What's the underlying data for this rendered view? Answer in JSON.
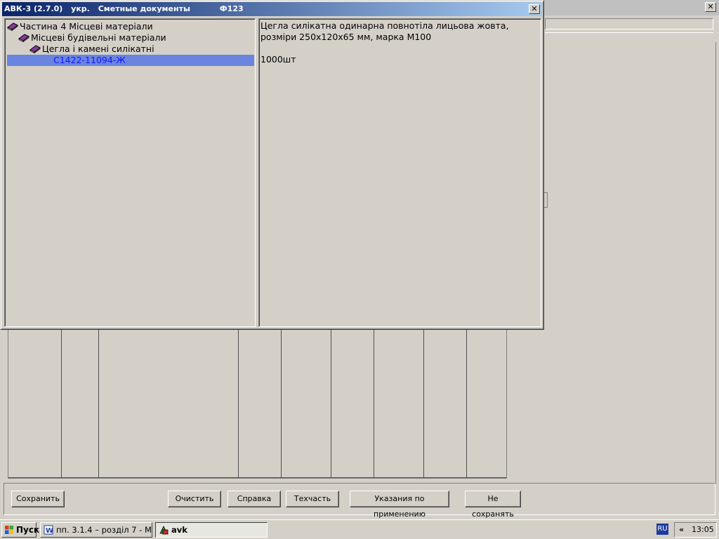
{
  "dialog": {
    "title_app": "АВК-3 (2.7.0)",
    "title_lang": "укр.",
    "title_section": "Сметные документы",
    "title_form": "Ф123",
    "close_glyph": "✕"
  },
  "background_window": {
    "close_glyph": "✕"
  },
  "tree": {
    "items": [
      {
        "label": "Частина 4 Місцеві матеріали",
        "level": 0
      },
      {
        "label": "Місцеві будівельні матеріали",
        "level": 1
      },
      {
        "label": "Цегла і камені силікатні",
        "level": 2
      }
    ],
    "selected": {
      "label": "С1422-11094-Ж"
    },
    "icon": "book-icon"
  },
  "description": {
    "text": "Цегла силікатна одинарна повнотіла лицьова жовта, розміри 250х120х65 мм, марка М100",
    "unit": "1000шт"
  },
  "buttons": {
    "save": "Сохранить",
    "clear": "Очистить",
    "help": "Справка",
    "techpart": "Техчасть",
    "instructions": "Указания по применению",
    "dont_save": "Не сохранять"
  },
  "taskbar": {
    "start": "Пуск",
    "task1": "пп. 3.1.4 – розділ 7 - Mi...",
    "task2": "avk",
    "lang": "RU",
    "tray_chevron": "«",
    "clock": "13:05"
  },
  "colors": {
    "titlebar_start": "#0a246a",
    "titlebar_end": "#a6caf0",
    "selection": "#6a85e0",
    "selected_text": "#1414ff",
    "book_icon": "#8a3aa0"
  }
}
